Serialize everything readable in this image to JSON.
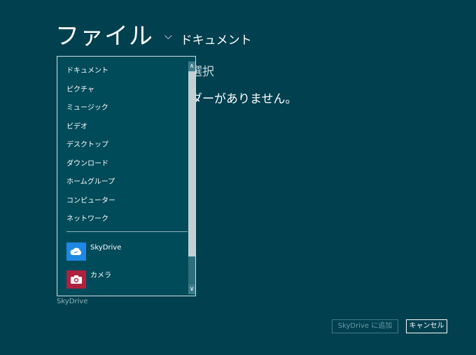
{
  "header": {
    "title": "ファイル",
    "dropdown_chevron": "chevron-down-icon",
    "location": "ドキュメント"
  },
  "background": {
    "select_text": "選択",
    "empty_message": "ダーがありません。"
  },
  "dropdown": {
    "items": [
      {
        "label": "ドキュメント"
      },
      {
        "label": "ピクチャ"
      },
      {
        "label": "ミュージック"
      },
      {
        "label": "ビデオ"
      },
      {
        "label": "デスクトップ"
      },
      {
        "label": "ダウンロード"
      },
      {
        "label": "ホームグループ"
      },
      {
        "label": "コンピューター"
      },
      {
        "label": "ネットワーク"
      }
    ],
    "services": [
      {
        "label": "SkyDrive",
        "icon": "cloud-icon",
        "color": "#1f88e5"
      },
      {
        "label": "カメラ",
        "icon": "camera-icon",
        "color": "#b0203f"
      }
    ]
  },
  "footer": {
    "location_label": "SkyDrive",
    "add_button": "SkyDrive に追加",
    "cancel_button": "キャンセル"
  },
  "colors": {
    "background": "#00404f",
    "dropdown_background": "#004b5a"
  }
}
